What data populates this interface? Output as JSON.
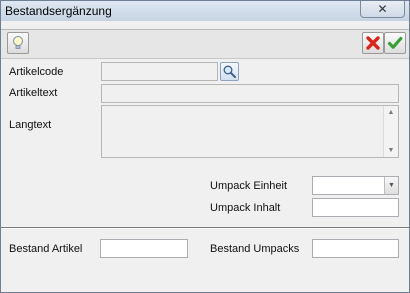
{
  "window": {
    "title": "Bestandsergänzung",
    "close_symbol": "✕"
  },
  "toolbar": {
    "help_icon": "lightbulb-icon",
    "cancel_icon": "red-x-icon",
    "ok_icon": "green-check-icon"
  },
  "form": {
    "artikelcode_label": "Artikelcode",
    "artikelcode_value": "",
    "search_icon": "magnifier-icon",
    "artikeltext_label": "Artikeltext",
    "artikeltext_value": "",
    "langtext_label": "Langtext",
    "langtext_value": "",
    "umpack_einheit_label": "Umpack Einheit",
    "umpack_einheit_value": "",
    "umpack_inhalt_label": "Umpack Inhalt",
    "umpack_inhalt_value": ""
  },
  "footer": {
    "bestand_artikel_label": "Bestand Artikel",
    "bestand_artikel_value": "",
    "bestand_umpacks_label": "Bestand Umpacks",
    "bestand_umpacks_value": ""
  },
  "colors": {
    "titlebar": "#c6d3e3",
    "cancel": "#d9261c",
    "ok": "#3aa035"
  }
}
